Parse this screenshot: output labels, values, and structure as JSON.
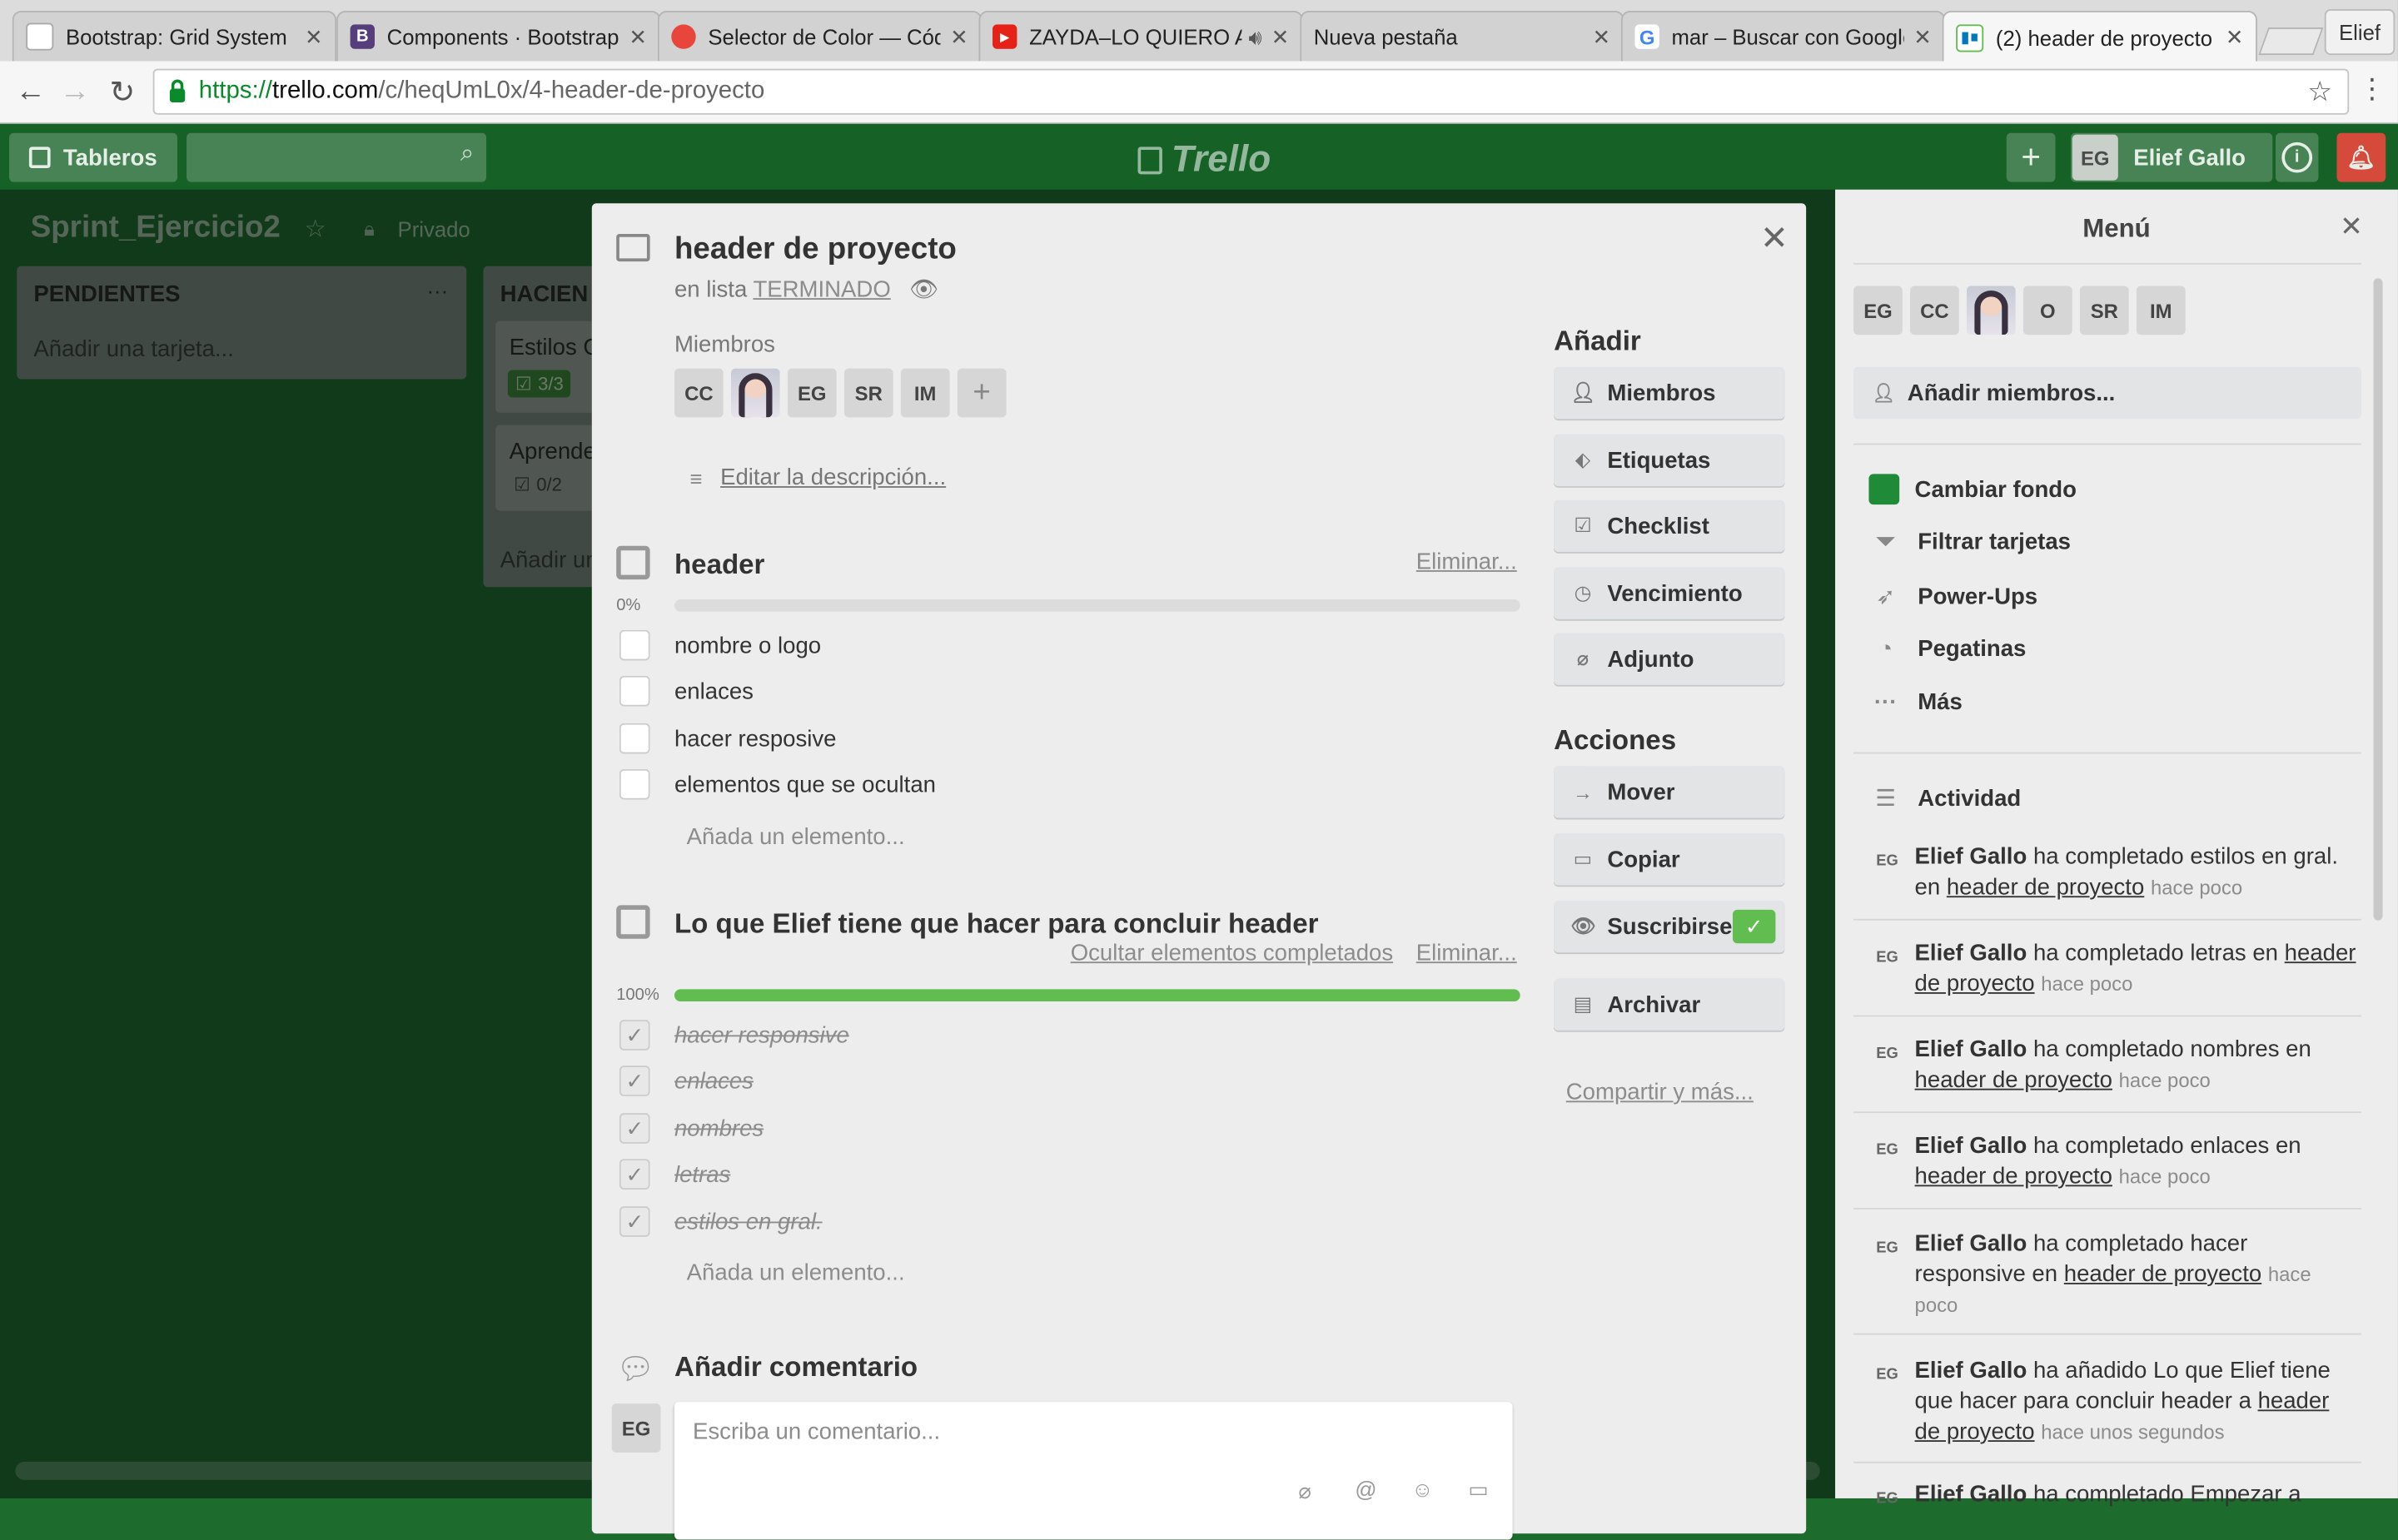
{
  "browser": {
    "tabs": [
      {
        "title": "Bootstrap: Grid System",
        "color": "#ffffff"
      },
      {
        "title": "Components · Bootstrap",
        "color": "#563d7c"
      },
      {
        "title": "Selector de Color — Códigos",
        "color": "#e8453c"
      },
      {
        "title": "ZAYDA–LO QUIERO A",
        "color": "#e62117"
      },
      {
        "title": "Nueva pestaña",
        "color": ""
      },
      {
        "title": "mar – Buscar con Google",
        "color": "#4285f4"
      },
      {
        "title": "(2) header de proyecto",
        "color": "#0079bf"
      }
    ],
    "profile_label": "Elief",
    "url_scheme": "https://",
    "url_host": "trello.com",
    "url_path": "/c/heqUmL0x/4-header-de-proyecto"
  },
  "trello_header": {
    "boards_label": "Tableros",
    "logo_text": "Trello",
    "add_symbol": "+",
    "user_initials": "EG",
    "user_name": "Elief Gallo",
    "info_symbol": "i"
  },
  "board": {
    "title": "Sprint_Ejercicio2",
    "visibility": "Privado",
    "lists": [
      {
        "name": "PENDIENTES",
        "add_card": "Añadir una tarjeta..."
      },
      {
        "name": "HACIEN",
        "cards": [
          {
            "title": "Estilos G",
            "badge": "3/3",
            "badge_color": "#61bd4f"
          },
          {
            "title": "Aprende",
            "badge": "0/2",
            "badge_color": ""
          }
        ],
        "add_card": "Añadir un"
      }
    ]
  },
  "card_modal": {
    "title": "header de proyecto",
    "in_list_prefix": "en lista",
    "list_name": "TERMINADO",
    "members_label": "Miembros",
    "members": [
      "CC",
      "",
      "EG",
      "SR",
      "IM"
    ],
    "add_member_symbol": "+",
    "edit_description": "Editar la descripción...",
    "checklists": [
      {
        "title": "header",
        "delete_label": "Eliminar...",
        "percent": "0%",
        "progress": 0,
        "items": [
          {
            "text": "nombre o logo",
            "done": false
          },
          {
            "text": "enlaces",
            "done": false
          },
          {
            "text": "hacer resposive",
            "done": false
          },
          {
            "text": "elementos que se ocultan",
            "done": false
          }
        ],
        "add_item": "Añada un elemento..."
      },
      {
        "title": "Lo que Elief tiene que hacer para concluir header",
        "hide_completed": "Ocultar elementos completados",
        "delete_label": "Eliminar...",
        "percent": "100%",
        "progress": 1,
        "items": [
          {
            "text": "hacer responsive",
            "done": true
          },
          {
            "text": "enlaces",
            "done": true
          },
          {
            "text": "nombres",
            "done": true
          },
          {
            "text": "letras",
            "done": true
          },
          {
            "text": "estilos en gral.",
            "done": true
          }
        ],
        "add_item": "Añada un elemento..."
      }
    ],
    "comment_heading": "Añadir comentario",
    "comment_avatar": "EG",
    "comment_placeholder": "Escriba un comentario...",
    "add_heading": "Añadir",
    "add_buttons": [
      "Miembros",
      "Etiquetas",
      "Checklist",
      "Vencimiento",
      "Adjunto"
    ],
    "actions_heading": "Acciones",
    "action_buttons": [
      "Mover",
      "Copiar",
      "Suscribirse",
      "Archivar"
    ],
    "share_link": "Compartir y más...",
    "close_symbol": "✕"
  },
  "menu": {
    "title": "Menú",
    "close_symbol": "✕",
    "members": [
      "EG",
      "CC",
      "",
      "O",
      "SR",
      "IM"
    ],
    "add_members": "Añadir miembros...",
    "items": [
      {
        "label": "Cambiar fondo",
        "icon": "color-swatch"
      },
      {
        "label": "Filtrar tarjetas",
        "icon": "filter"
      },
      {
        "label": "Power-Ups",
        "icon": "rocket"
      },
      {
        "label": "Pegatinas",
        "icon": "sticker"
      },
      {
        "label": "Más",
        "icon": "ellipsis"
      }
    ],
    "activity_heading": "Actividad",
    "activity": [
      {
        "avatar": "EG",
        "user": "Elief Gallo",
        "text": "ha completado estilos en gral. en",
        "link": "header de proyecto",
        "time": "hace poco"
      },
      {
        "avatar": "EG",
        "user": "Elief Gallo",
        "text": "ha completado letras en",
        "link": "header de proyecto",
        "time": "hace poco"
      },
      {
        "avatar": "EG",
        "user": "Elief Gallo",
        "text": "ha completado nombres en",
        "link": "header de proyecto",
        "time": "hace poco"
      },
      {
        "avatar": "EG",
        "user": "Elief Gallo",
        "text": "ha completado enlaces en",
        "link": "header de proyecto",
        "time": "hace poco"
      },
      {
        "avatar": "EG",
        "user": "Elief Gallo",
        "text": "ha completado hacer responsive en",
        "link": "header de proyecto",
        "time": "hace poco"
      },
      {
        "avatar": "EG",
        "user": "Elief Gallo",
        "text": "ha añadido Lo que Elief tiene que hacer para concluir header a",
        "link": "header de proyecto",
        "time": "hace unos segundos"
      },
      {
        "avatar": "EG",
        "user": "Elief Gallo",
        "text": "ha completado Empezar a",
        "link": "",
        "time": ""
      }
    ]
  },
  "colors": {
    "board_bg": "#1f6f31",
    "accent_green": "#61bd4f",
    "notification_red": "#d64a3b"
  }
}
